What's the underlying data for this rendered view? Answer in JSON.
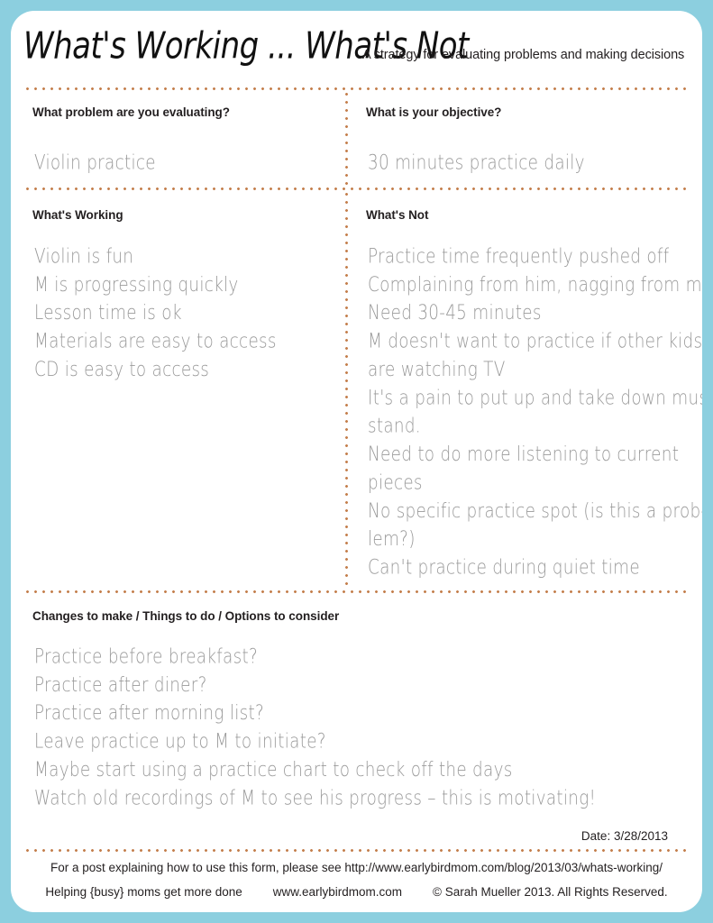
{
  "header": {
    "title": "What's Working ... What's Not",
    "subtitle": "A strategy for evaluating problems and making decisions"
  },
  "fields": {
    "problem": {
      "label": "What problem are you evaluating?",
      "value": "Violin practice"
    },
    "objective": {
      "label": "What is your objective?",
      "value": "30 minutes practice daily"
    },
    "working": {
      "label": "What's Working",
      "lines": [
        "Violin is fun",
        "M is progressing quickly",
        "Lesson time is ok",
        "Materials are easy to access",
        "CD is easy to access"
      ]
    },
    "not_working": {
      "label": "What's Not",
      "lines": [
        "Practice time frequently pushed off",
        "Complaining from him, nagging from me",
        "Need 30-45 minutes",
        "M doesn't want to practice if other kids",
        "are watching TV",
        "It's a pain to put up and take down music",
        "stand.",
        "Need to do more listening to current",
        "pieces",
        "No specific practice spot (is this a prob-",
        "lem?)",
        "Can't practice during quiet time"
      ]
    },
    "changes": {
      "label": "Changes to make / Things to do / Options to consider",
      "lines": [
        "Practice before breakfast?",
        "Practice after diner?",
        "Practice after morning list?",
        "Leave practice up to M to initiate?",
        "Maybe start using a practice chart to check off the days",
        "Watch old recordings of M to see his progress – this is motivating!"
      ]
    }
  },
  "footer": {
    "date": "Date: 3/28/2013",
    "post_note": "For a post explaining how to use this form, please see http://www.earlybirdmom.com/blog/2013/03/whats-working/",
    "tagline": "Helping {busy} moms get more done",
    "site": "www.earlybirdmom.com",
    "copyright": "© Sarah Mueller 2013. All Rights Reserved."
  },
  "colors": {
    "background": "#8ccfdf",
    "card": "#ffffff",
    "dotted_rule": "#c47f4d",
    "handwriting": "#9a9a9a",
    "text": "#231f20"
  }
}
